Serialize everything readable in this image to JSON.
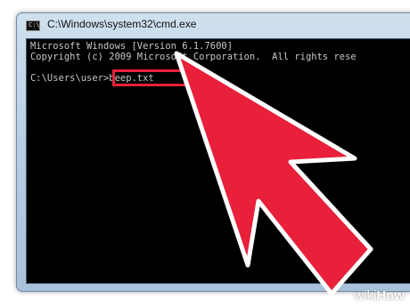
{
  "window": {
    "title": "C:\\Windows\\system32\\cmd.exe",
    "icon": "console-icon"
  },
  "console": {
    "lines": [
      "Microsoft Windows [Version 6.1.7600]",
      "Copyright (c) 2009 Microsoft Corporation.  All rights rese",
      "C:\\Users\\user>beep.txt"
    ]
  },
  "annotation": {
    "highlight_color": "#e8203a",
    "arrow_color": "#e8203a",
    "arrow_icon": "pointer-arrow-icon"
  },
  "watermark": {
    "prefix": "wiki",
    "suffix": "How"
  }
}
